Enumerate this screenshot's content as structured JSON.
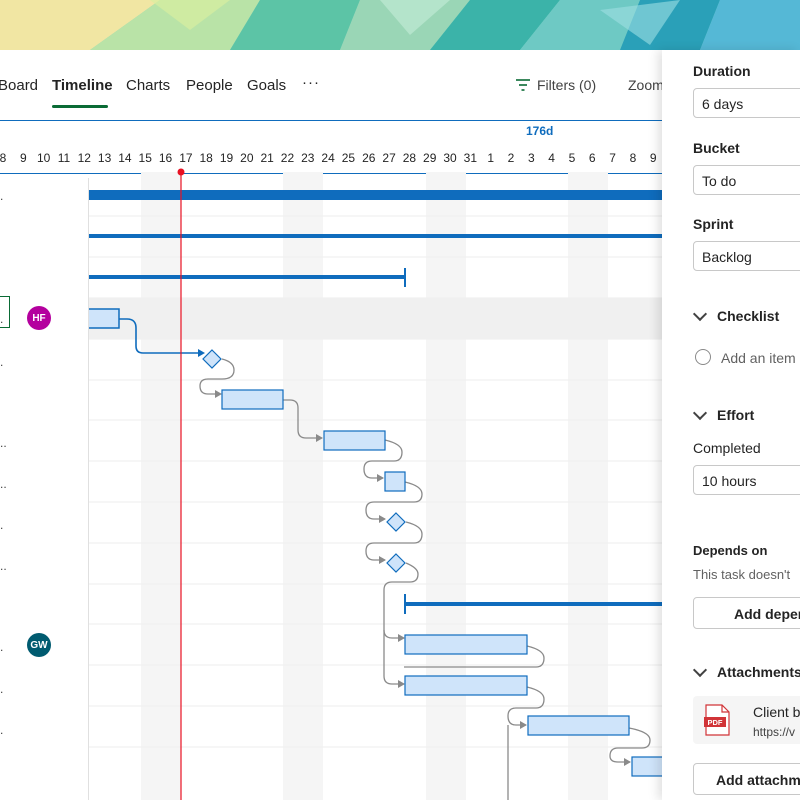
{
  "nav": {
    "tabs": [
      {
        "label": "Board",
        "active": false
      },
      {
        "label": "Timeline",
        "active": true
      },
      {
        "label": "Charts",
        "active": false
      },
      {
        "label": "People",
        "active": false
      },
      {
        "label": "Goals",
        "active": false
      }
    ],
    "more_label": "···",
    "filters_label": "Filters (0)",
    "zoom_label": "Zoom"
  },
  "timeline": {
    "duration_label": "176d",
    "days": [
      "8",
      "9",
      "10",
      "11",
      "12",
      "13",
      "14",
      "15",
      "16",
      "17",
      "18",
      "19",
      "20",
      "21",
      "22",
      "23",
      "24",
      "25",
      "26",
      "27",
      "28",
      "29",
      "30",
      "31",
      "1",
      "2",
      "3",
      "4",
      "5",
      "6",
      "7",
      "8",
      "9"
    ],
    "today": "17"
  },
  "assignees": [
    {
      "initials": "HF",
      "color": "#b4009e"
    },
    {
      "initials": "GW",
      "color": "#005b70"
    }
  ],
  "panel": {
    "duration_label": "Duration",
    "duration_value": "6 days",
    "bucket_label": "Bucket",
    "bucket_value": "To do",
    "sprint_label": "Sprint",
    "sprint_value": "Backlog",
    "checklist_label": "Checklist",
    "checklist_placeholder": "Add an item",
    "effort_label": "Effort",
    "completed_label": "Completed",
    "completed_value": "10 hours",
    "depends_label": "Depends on",
    "depends_text": "This task doesn't",
    "add_dependency_label": "Add depen",
    "attachments_label": "Attachments",
    "attachment_name": "Client b",
    "attachment_url": "https://v",
    "add_attachment_label": "Add attachm"
  },
  "colors": {
    "accent_green": "#0a6b35",
    "accent_blue": "#0f6cbd",
    "today_line": "#e81123",
    "task_fill": "#cfe4fa"
  }
}
